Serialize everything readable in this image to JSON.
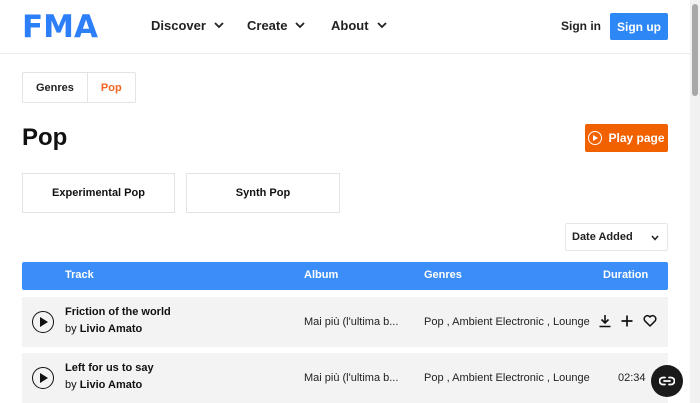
{
  "header": {
    "logo": "FMA",
    "nav": [
      {
        "label": "Discover"
      },
      {
        "label": "Create"
      },
      {
        "label": "About"
      }
    ],
    "sign_in": "Sign in",
    "sign_up": "Sign up"
  },
  "breadcrumb": {
    "items": [
      {
        "label": "Genres"
      },
      {
        "label": "Pop"
      }
    ]
  },
  "page": {
    "title": "Pop",
    "play_page_label": "Play page"
  },
  "subgenres": [
    {
      "label": "Experimental Pop"
    },
    {
      "label": "Synth Pop"
    }
  ],
  "sort": {
    "selected": "Date Added"
  },
  "table": {
    "headers": {
      "track": "Track",
      "album": "Album",
      "genres": "Genres",
      "duration": "Duration"
    },
    "rows": [
      {
        "title": "Friction of the world",
        "by": "by",
        "artist": "Livio Amato",
        "album": "Mai più (l'ultima b...",
        "genres": "Pop , Ambient Electronic , Lounge",
        "duration": ""
      },
      {
        "title": "Left for us to say",
        "by": "by",
        "artist": "Livio Amato",
        "album": "Mai più (l'ultima b...",
        "genres": "Pop , Ambient Electronic , Lounge",
        "duration": "02:34"
      }
    ]
  },
  "colors": {
    "brand_blue": "#2d7ff9",
    "accent_orange": "#f26100",
    "table_header": "#3b8ef7"
  }
}
